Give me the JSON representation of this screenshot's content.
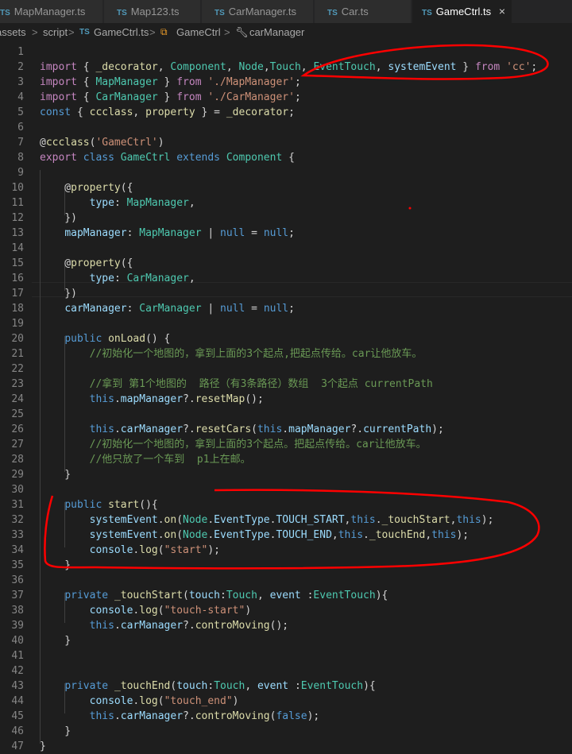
{
  "tabs": [
    {
      "label": "MapManager.ts",
      "icon": "ts-file-icon"
    },
    {
      "label": "Map123.ts",
      "icon": "ts-file-icon"
    },
    {
      "label": "CarManager.ts",
      "icon": "ts-file-icon"
    },
    {
      "label": "Car.ts",
      "icon": "ts-file-icon"
    },
    {
      "label": "GameCtrl.ts",
      "icon": "ts-file-icon",
      "active": true,
      "close": "×"
    }
  ],
  "breadcrumb": {
    "items": [
      "assets",
      "script",
      "GameCtrl.ts",
      "GameCtrl",
      "carManager"
    ],
    "separator": ">"
  },
  "ts_badge": "TS",
  "line_numbers": [
    "1",
    "2",
    "3",
    "4",
    "5",
    "6",
    "7",
    "8",
    "9",
    "10",
    "11",
    "12",
    "13",
    "14",
    "15",
    "16",
    "17",
    "18",
    "19",
    "20",
    "21",
    "22",
    "23",
    "24",
    "25",
    "26",
    "27",
    "28",
    "29",
    "30",
    "31",
    "32",
    "33",
    "34",
    "35",
    "36",
    "37",
    "38",
    "39",
    "40",
    "41",
    "42",
    "43",
    "44",
    "45",
    "46",
    "47"
  ],
  "code_lines": [
    "",
    "import { _decorator, Component, Node,Touch, EventTouch, systemEvent } from 'cc';",
    "import { MapManager } from './MapManager';",
    "import { CarManager } from './CarManager';",
    "const { ccclass, property } = _decorator;",
    "",
    "@ccclass('GameCtrl')",
    "export class GameCtrl extends Component {",
    "",
    "    @property({",
    "        type: MapManager,",
    "    })",
    "    mapManager: MapManager | null = null;",
    "",
    "    @property({",
    "        type: CarManager,",
    "    })",
    "    carManager: CarManager | null = null;",
    "",
    "    public onLoad() {",
    "        //初始化一个地图的，拿到上面的3个起点,把起点传给。car让他放车。",
    "",
    "        //拿到 第1个地图的  路径（有3条路径）数组  3个起点 currentPath",
    "        this.mapManager?.resetMap();",
    "",
    "        this.carManager?.resetCars(this.mapManager?.currentPath);",
    "        //初始化一个地图的，拿到上面的3个起点。把起点传给。car让他放车。",
    "        //他只放了一个车到  p1上在邮。",
    "    }",
    "",
    "    public start(){",
    "        systemEvent.on(Node.EventType.TOUCH_START,this._touchStart,this);",
    "        systemEvent.on(Node.EventType.TOUCH_END,this._touchEnd,this);",
    "        console.log(\"start\");",
    "    }",
    "",
    "    private _touchStart(touch:Touch, event :EventTouch){",
    "        console.log(\"touch-start\")",
    "        this.carManager?.controMoving();",
    "    }",
    "",
    "",
    "    private _touchEnd(touch:Touch, event :EventTouch){",
    "        console.log(\"touch_end\")",
    "        this.carManager?.controMoving(false);",
    "    }",
    "}"
  ],
  "colors": {
    "background": "#1e1e1e",
    "tab_bar": "#252526",
    "keyword": "#569cd6",
    "control_keyword": "#c586c0",
    "type": "#4ec9b0",
    "variable": "#9cdcfe",
    "string": "#ce9178",
    "function": "#dcdcaa",
    "comment": "#6a9955",
    "annotation": "#ff0000"
  }
}
